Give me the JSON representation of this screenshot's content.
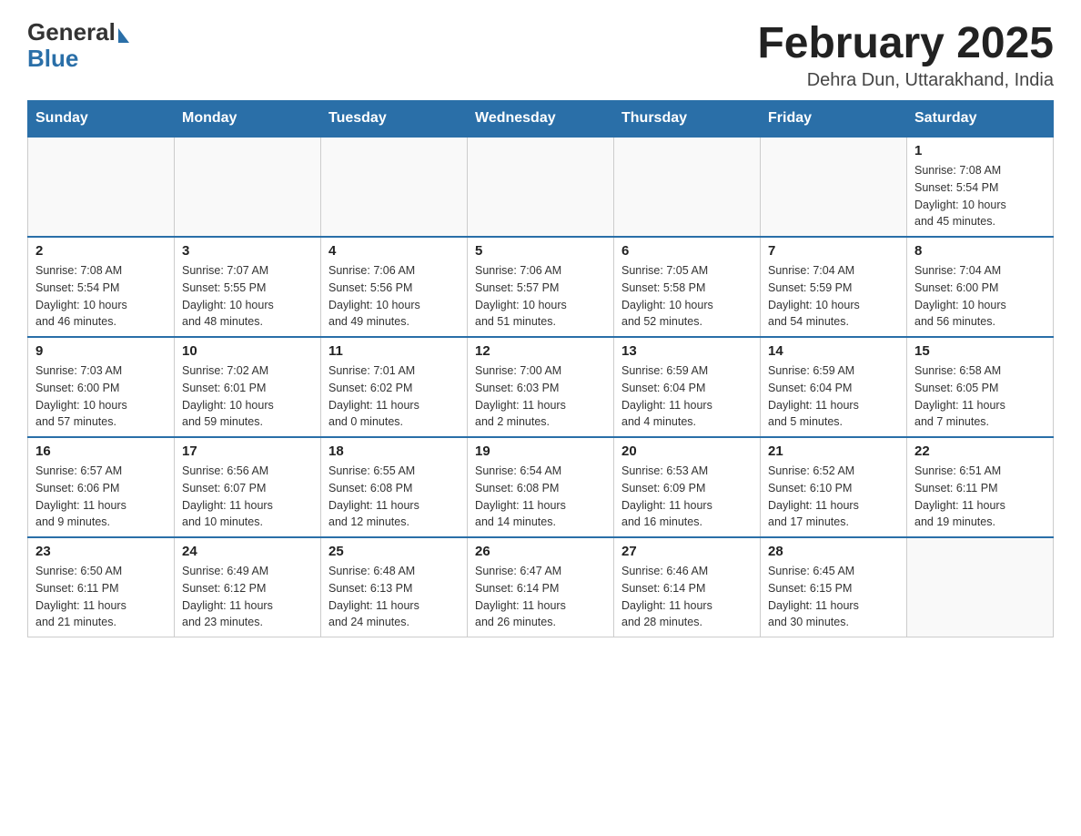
{
  "header": {
    "logo_general": "General",
    "logo_blue": "Blue",
    "month_year": "February 2025",
    "location": "Dehra Dun, Uttarakhand, India"
  },
  "weekdays": [
    "Sunday",
    "Monday",
    "Tuesday",
    "Wednesday",
    "Thursday",
    "Friday",
    "Saturday"
  ],
  "weeks": [
    [
      {
        "day": "",
        "info": ""
      },
      {
        "day": "",
        "info": ""
      },
      {
        "day": "",
        "info": ""
      },
      {
        "day": "",
        "info": ""
      },
      {
        "day": "",
        "info": ""
      },
      {
        "day": "",
        "info": ""
      },
      {
        "day": "1",
        "info": "Sunrise: 7:08 AM\nSunset: 5:54 PM\nDaylight: 10 hours\nand 45 minutes."
      }
    ],
    [
      {
        "day": "2",
        "info": "Sunrise: 7:08 AM\nSunset: 5:54 PM\nDaylight: 10 hours\nand 46 minutes."
      },
      {
        "day": "3",
        "info": "Sunrise: 7:07 AM\nSunset: 5:55 PM\nDaylight: 10 hours\nand 48 minutes."
      },
      {
        "day": "4",
        "info": "Sunrise: 7:06 AM\nSunset: 5:56 PM\nDaylight: 10 hours\nand 49 minutes."
      },
      {
        "day": "5",
        "info": "Sunrise: 7:06 AM\nSunset: 5:57 PM\nDaylight: 10 hours\nand 51 minutes."
      },
      {
        "day": "6",
        "info": "Sunrise: 7:05 AM\nSunset: 5:58 PM\nDaylight: 10 hours\nand 52 minutes."
      },
      {
        "day": "7",
        "info": "Sunrise: 7:04 AM\nSunset: 5:59 PM\nDaylight: 10 hours\nand 54 minutes."
      },
      {
        "day": "8",
        "info": "Sunrise: 7:04 AM\nSunset: 6:00 PM\nDaylight: 10 hours\nand 56 minutes."
      }
    ],
    [
      {
        "day": "9",
        "info": "Sunrise: 7:03 AM\nSunset: 6:00 PM\nDaylight: 10 hours\nand 57 minutes."
      },
      {
        "day": "10",
        "info": "Sunrise: 7:02 AM\nSunset: 6:01 PM\nDaylight: 10 hours\nand 59 minutes."
      },
      {
        "day": "11",
        "info": "Sunrise: 7:01 AM\nSunset: 6:02 PM\nDaylight: 11 hours\nand 0 minutes."
      },
      {
        "day": "12",
        "info": "Sunrise: 7:00 AM\nSunset: 6:03 PM\nDaylight: 11 hours\nand 2 minutes."
      },
      {
        "day": "13",
        "info": "Sunrise: 6:59 AM\nSunset: 6:04 PM\nDaylight: 11 hours\nand 4 minutes."
      },
      {
        "day": "14",
        "info": "Sunrise: 6:59 AM\nSunset: 6:04 PM\nDaylight: 11 hours\nand 5 minutes."
      },
      {
        "day": "15",
        "info": "Sunrise: 6:58 AM\nSunset: 6:05 PM\nDaylight: 11 hours\nand 7 minutes."
      }
    ],
    [
      {
        "day": "16",
        "info": "Sunrise: 6:57 AM\nSunset: 6:06 PM\nDaylight: 11 hours\nand 9 minutes."
      },
      {
        "day": "17",
        "info": "Sunrise: 6:56 AM\nSunset: 6:07 PM\nDaylight: 11 hours\nand 10 minutes."
      },
      {
        "day": "18",
        "info": "Sunrise: 6:55 AM\nSunset: 6:08 PM\nDaylight: 11 hours\nand 12 minutes."
      },
      {
        "day": "19",
        "info": "Sunrise: 6:54 AM\nSunset: 6:08 PM\nDaylight: 11 hours\nand 14 minutes."
      },
      {
        "day": "20",
        "info": "Sunrise: 6:53 AM\nSunset: 6:09 PM\nDaylight: 11 hours\nand 16 minutes."
      },
      {
        "day": "21",
        "info": "Sunrise: 6:52 AM\nSunset: 6:10 PM\nDaylight: 11 hours\nand 17 minutes."
      },
      {
        "day": "22",
        "info": "Sunrise: 6:51 AM\nSunset: 6:11 PM\nDaylight: 11 hours\nand 19 minutes."
      }
    ],
    [
      {
        "day": "23",
        "info": "Sunrise: 6:50 AM\nSunset: 6:11 PM\nDaylight: 11 hours\nand 21 minutes."
      },
      {
        "day": "24",
        "info": "Sunrise: 6:49 AM\nSunset: 6:12 PM\nDaylight: 11 hours\nand 23 minutes."
      },
      {
        "day": "25",
        "info": "Sunrise: 6:48 AM\nSunset: 6:13 PM\nDaylight: 11 hours\nand 24 minutes."
      },
      {
        "day": "26",
        "info": "Sunrise: 6:47 AM\nSunset: 6:14 PM\nDaylight: 11 hours\nand 26 minutes."
      },
      {
        "day": "27",
        "info": "Sunrise: 6:46 AM\nSunset: 6:14 PM\nDaylight: 11 hours\nand 28 minutes."
      },
      {
        "day": "28",
        "info": "Sunrise: 6:45 AM\nSunset: 6:15 PM\nDaylight: 11 hours\nand 30 minutes."
      },
      {
        "day": "",
        "info": ""
      }
    ]
  ]
}
